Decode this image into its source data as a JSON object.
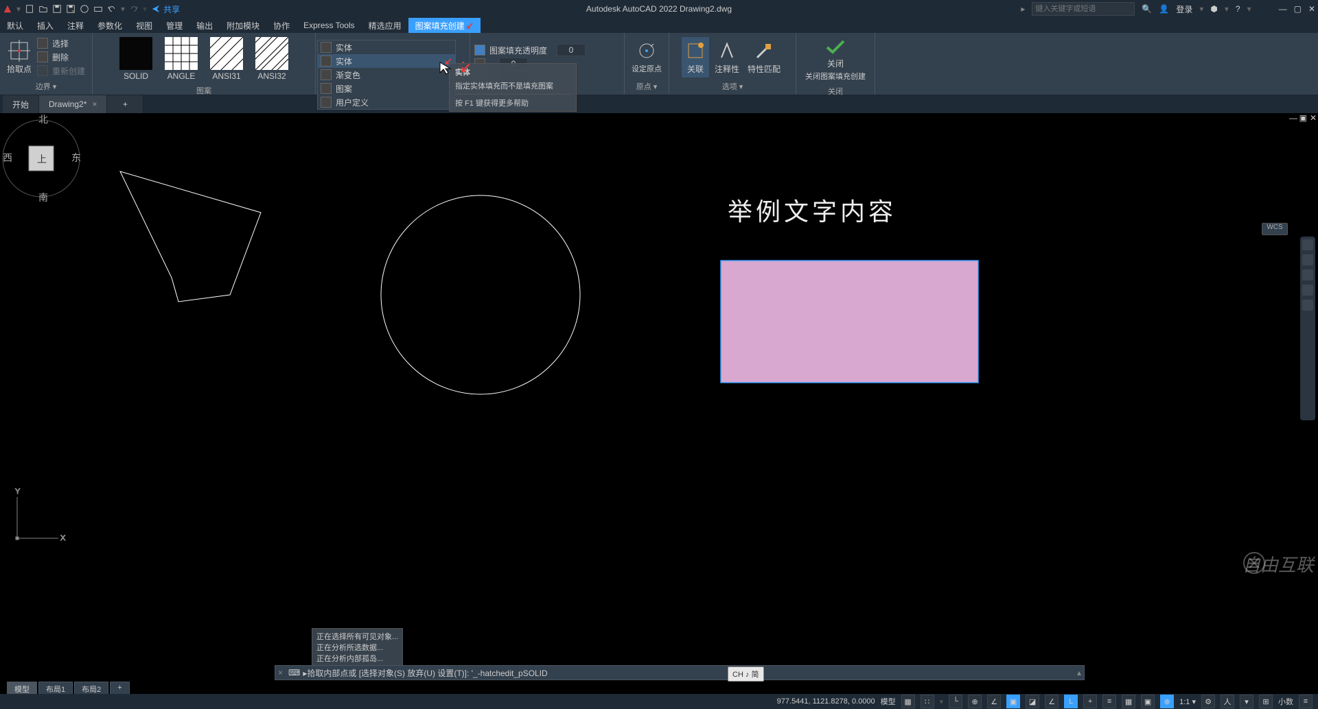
{
  "app": {
    "title": "Autodesk AutoCAD 2022   Drawing2.dwg"
  },
  "titlebar": {
    "share": "共享",
    "search_placeholder": "键入关键字或短语",
    "login": "登录"
  },
  "menu": {
    "items": [
      "默认",
      "插入",
      "注释",
      "参数化",
      "视图",
      "管理",
      "输出",
      "附加模块",
      "协作",
      "Express Tools",
      "精选应用",
      "图案填充创建"
    ],
    "active_index": 11
  },
  "ribbon": {
    "panels": {
      "boundary": {
        "label": "边界 ▾",
        "pick_point": "拾取点",
        "select": "选择",
        "delete": "删除",
        "recreate": "重新创建"
      },
      "pattern": {
        "label": "图案",
        "swatches": [
          {
            "name": "SOLID"
          },
          {
            "name": "ANGLE"
          },
          {
            "name": "ANSI31"
          },
          {
            "name": "ANSI32"
          }
        ]
      },
      "type_dd": {
        "items": [
          "实体",
          "实体",
          "渐变色",
          "图案",
          "用户定义"
        ]
      },
      "props": {
        "transparency_label": "图案填充透明度",
        "transparency_value": "0",
        "angle_value": "0"
      },
      "origin": {
        "btn": "设定原点",
        "label": "原点 ▾"
      },
      "options": {
        "assoc": "关联",
        "anno": "注释性",
        "match": "特性匹配",
        "label": "选项 ▾"
      },
      "close": {
        "btn": "关闭图案填充创建",
        "line1": "关闭",
        "label": "关闭"
      }
    }
  },
  "tooltip": {
    "title": "实体",
    "line1": "指定实体填充而不是填充图案",
    "line2": "按 F1 键获得更多帮助"
  },
  "doctabs": {
    "start": "开始",
    "doc": "Drawing2*",
    "plus": "+"
  },
  "canvas": {
    "sample_text": "举例文字内容",
    "wcs": "WCS",
    "cube": {
      "n": "北",
      "s": "南",
      "e": "东",
      "w": "西",
      "top": "上"
    }
  },
  "cmd": {
    "hist": [
      "正在选择所有可见对象...",
      "正在分析所选数据...",
      "正在分析内部孤岛..."
    ],
    "close_x": "×",
    "prompt": "▸拾取内部点或 [选择对象(S) 放弃(U) 设置(T)]: '_-hatchedit_pSOLID"
  },
  "ime": "CH ♪ 简",
  "layouts": [
    "模型",
    "布局1",
    "布局2",
    "+"
  ],
  "status": {
    "coords": "977.5441, 1121.8278, 0.0000",
    "model": "模型",
    "scale": "1:1 ▾",
    "decimal": "小数"
  },
  "watermark": "自由互联"
}
